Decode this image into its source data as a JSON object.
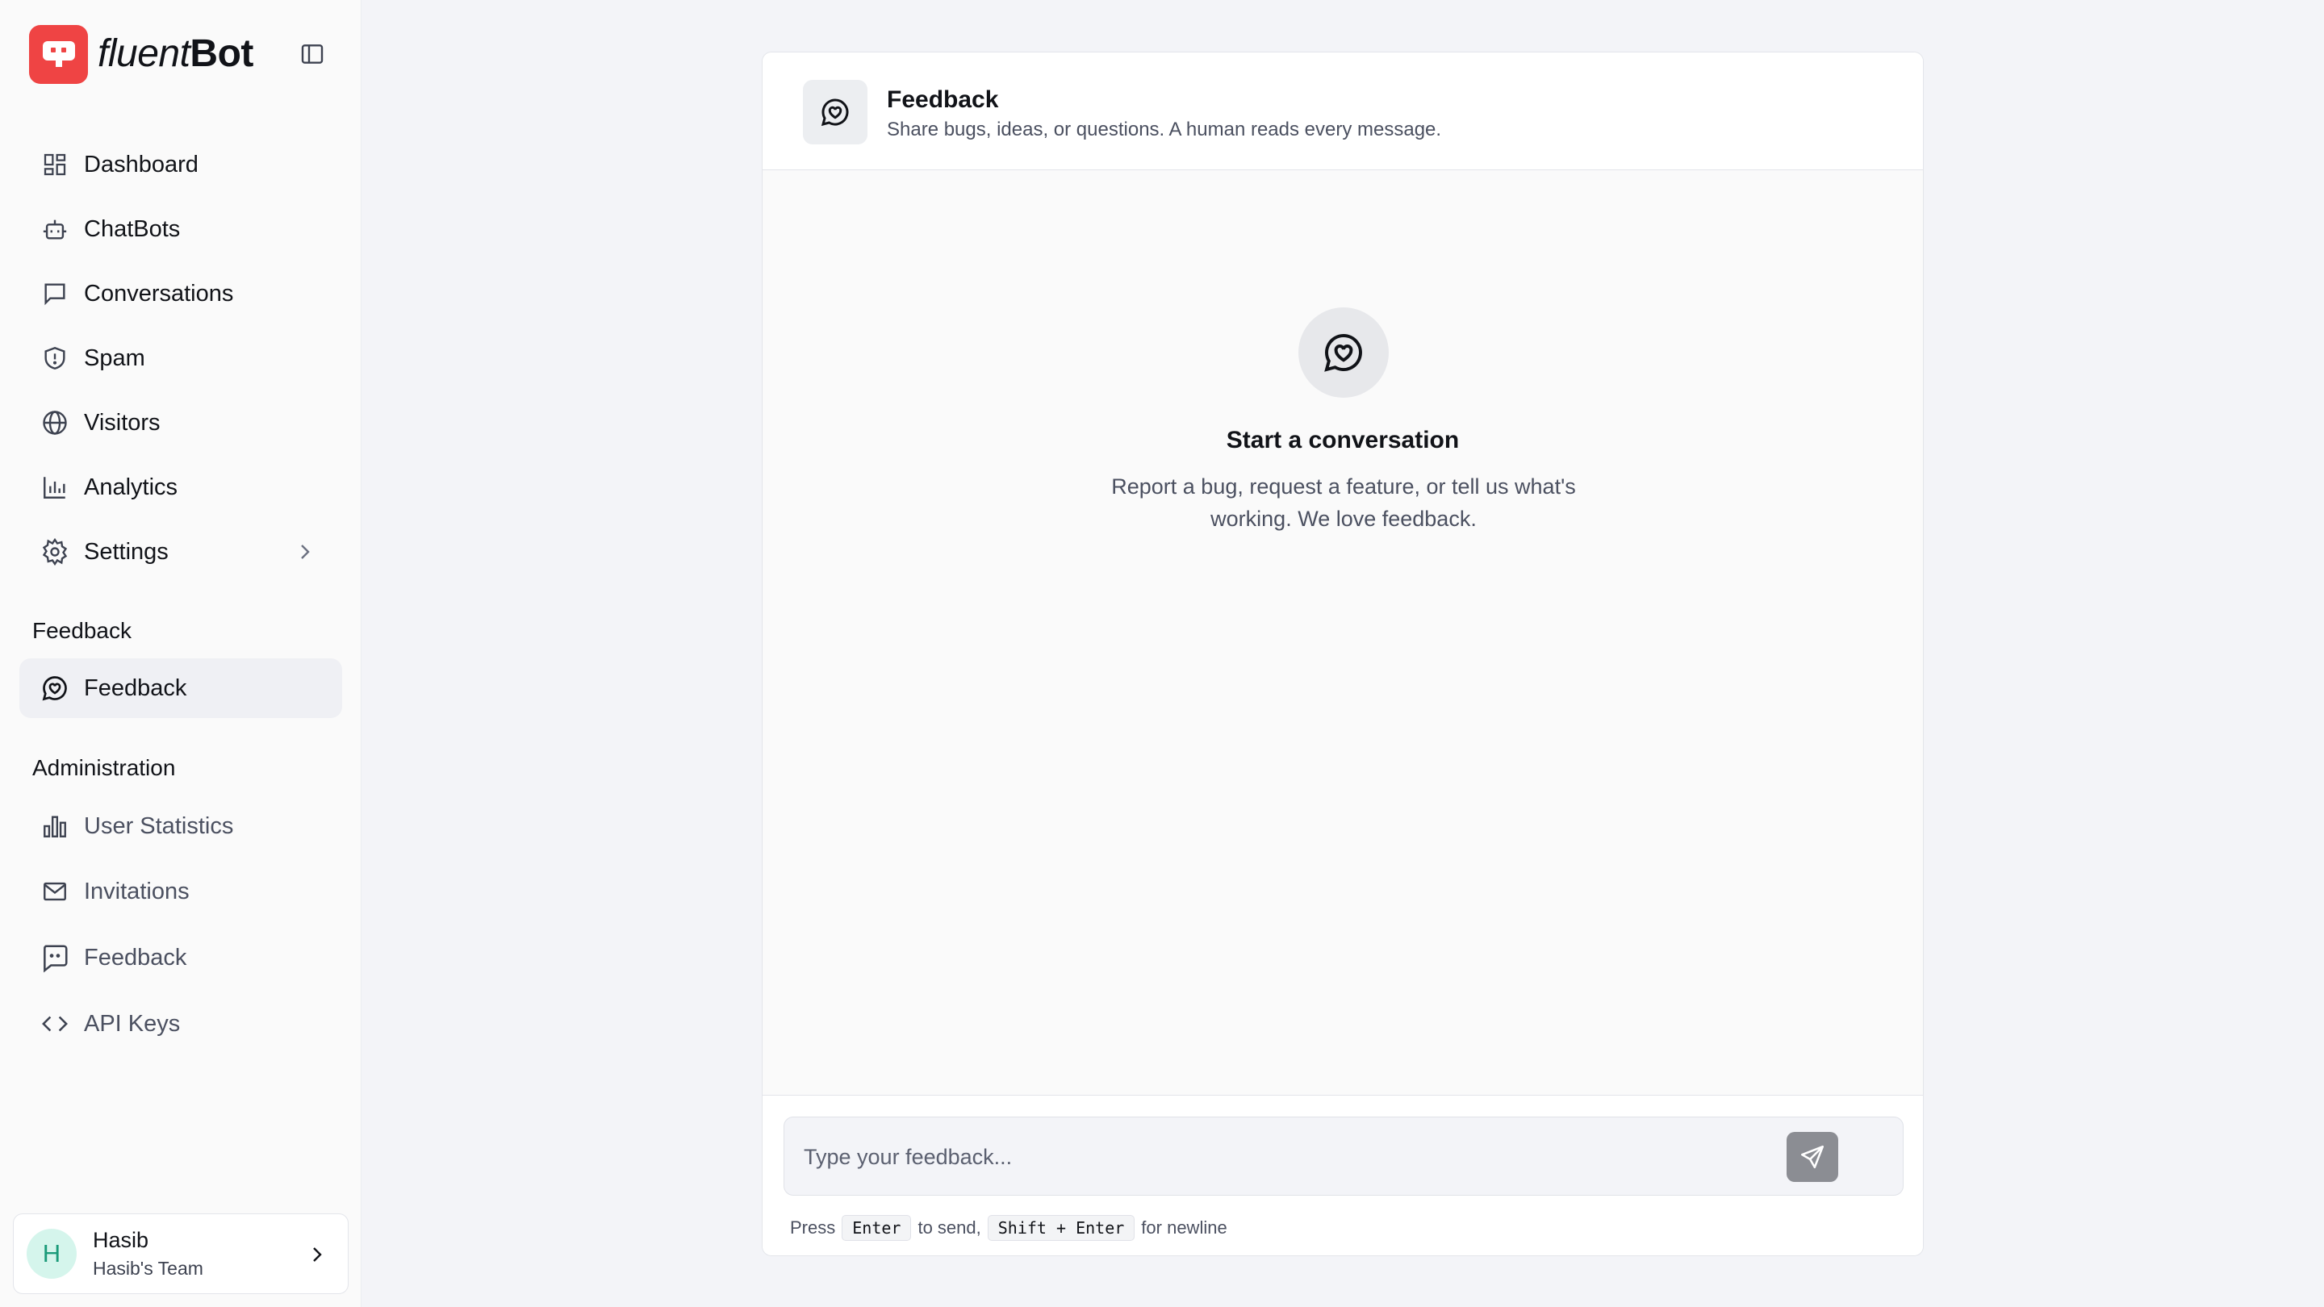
{
  "app": {
    "brand_prefix": "fluent",
    "brand_suffix": "Bot"
  },
  "sidebar": {
    "nav": [
      {
        "label": "Dashboard",
        "icon": "dashboard-icon"
      },
      {
        "label": "ChatBots",
        "icon": "bot-icon"
      },
      {
        "label": "Conversations",
        "icon": "message-square-icon"
      },
      {
        "label": "Spam",
        "icon": "shield-alert-icon"
      },
      {
        "label": "Visitors",
        "icon": "globe-icon"
      },
      {
        "label": "Analytics",
        "icon": "bar-chart-icon"
      },
      {
        "label": "Settings",
        "icon": "gear-icon"
      }
    ],
    "feedback_section": {
      "title": "Feedback",
      "items": [
        {
          "label": "Feedback",
          "icon": "message-heart-icon",
          "active": true
        }
      ]
    },
    "admin_section": {
      "title": "Administration",
      "items": [
        {
          "label": "User Statistics",
          "icon": "chart-columns-icon"
        },
        {
          "label": "Invitations",
          "icon": "mail-icon"
        },
        {
          "label": "Feedback",
          "icon": "message-dots-icon"
        },
        {
          "label": "API Keys",
          "icon": "code-icon"
        }
      ]
    },
    "user": {
      "initial": "H",
      "name": "Hasib",
      "team": "Hasib's Team"
    }
  },
  "panel": {
    "title": "Feedback",
    "subtitle": "Share bugs, ideas, or questions. A human reads every message.",
    "empty_title": "Start a conversation",
    "empty_body": "Report a bug, request a feature, or tell us what's working. We love feedback.",
    "input_placeholder": "Type your feedback...",
    "input_value": "",
    "hint": {
      "press": "Press",
      "send_key": "Enter",
      "to_send": "to send,",
      "newline_key": "Shift + Enter",
      "for_newline": "for newline"
    }
  },
  "colors": {
    "brand": "#ef4444",
    "active_nav_bg": "#eff0f4",
    "send_button": "#8b8d93",
    "avatar_bg": "#d5f5ec"
  }
}
